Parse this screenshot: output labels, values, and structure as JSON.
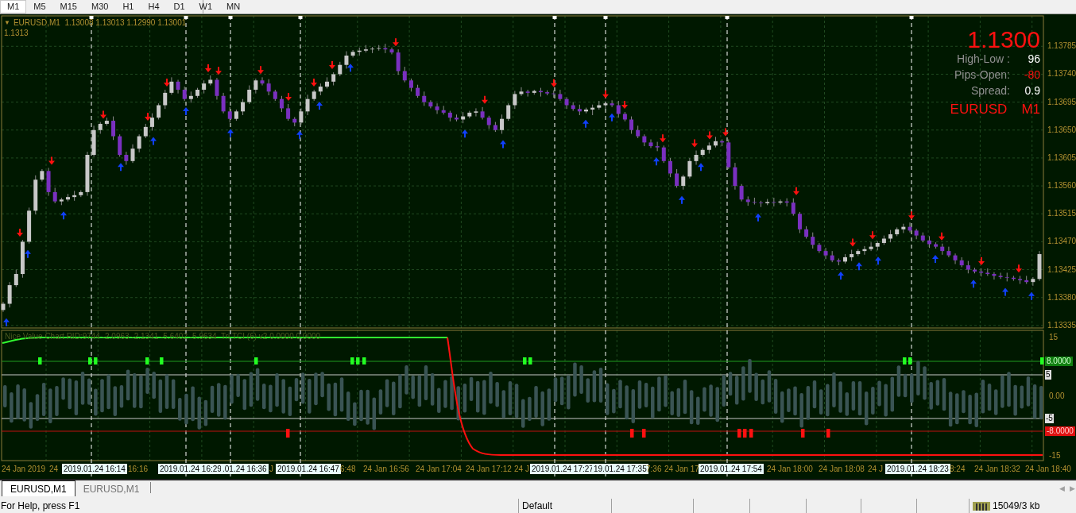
{
  "timeframes": [
    {
      "label": "M1",
      "selected": true
    },
    {
      "label": "M5",
      "selected": false
    },
    {
      "label": "M15",
      "selected": false
    },
    {
      "label": "M30",
      "selected": false
    },
    {
      "label": "H1",
      "selected": false
    },
    {
      "label": "H4",
      "selected": false
    },
    {
      "label": "D1",
      "selected": false
    },
    {
      "label": "W1",
      "selected": false
    },
    {
      "label": "MN",
      "selected": false
    }
  ],
  "chart": {
    "menu_glyph": "▼",
    "header": "EURUSD,M1  1.13008 1.13013 1.12990 1.13001",
    "header_line_2": "1.1313",
    "info_panel": {
      "price": "1.1300",
      "rows": [
        {
          "label": "High-Low :",
          "value": "96",
          "kind": "neutral"
        },
        {
          "label": "Pips-Open:",
          "value": "-80",
          "kind": "negative"
        },
        {
          "label": "Spread:",
          "value": "0.9",
          "kind": "neutral"
        }
      ],
      "symbol": "EURUSD",
      "period": "M1"
    },
    "chart_data": {
      "type": "candlestick",
      "grid": true,
      "ylim": [
        1.13331,
        1.13834
      ],
      "yticks": [
        {
          "value": 1.13785,
          "label": "1.13785"
        },
        {
          "value": 1.1374,
          "label": "1.13740"
        },
        {
          "value": 1.13695,
          "label": "1.13695"
        },
        {
          "value": 1.1365,
          "label": "1.13650"
        },
        {
          "value": 1.13605,
          "label": "1.13605"
        },
        {
          "value": 1.1356,
          "label": "1.13560"
        },
        {
          "value": 1.13515,
          "label": "1.13515"
        },
        {
          "value": 1.1347,
          "label": "1.13470"
        },
        {
          "value": 1.13425,
          "label": "1.13425"
        },
        {
          "value": 1.1338,
          "label": "1.13380"
        },
        {
          "value": 1.13335,
          "label": "1.13335"
        }
      ],
      "ohlc": [
        [
          1.1336,
          1.13373,
          1.13357,
          1.1337
        ],
        [
          1.1337,
          1.13405,
          1.13364,
          1.134
        ],
        [
          1.134,
          1.13425,
          1.13397,
          1.13418
        ],
        [
          1.13418,
          1.13473,
          1.13412,
          1.1347
        ],
        [
          1.1347,
          1.13525,
          1.13467,
          1.1352
        ],
        [
          1.1352,
          1.13577,
          1.13514,
          1.1357
        ],
        [
          1.1357,
          1.13587,
          1.13567,
          1.13584
        ],
        [
          1.13584,
          1.13589,
          1.13544,
          1.1355
        ],
        [
          1.1355,
          1.13557,
          1.13532,
          1.13535
        ],
        [
          1.13535,
          1.13541,
          1.13529,
          1.13538
        ],
        [
          1.13538,
          1.13547,
          1.13535,
          1.13542
        ],
        [
          1.13542,
          1.13552,
          1.13536,
          1.13545
        ],
        [
          1.13545,
          1.13553,
          1.13542,
          1.1355
        ],
        [
          1.1355,
          1.13615,
          1.13544,
          1.1361
        ],
        [
          1.1361,
          1.13657,
          1.13607,
          1.1365
        ],
        [
          1.1365,
          1.13663,
          1.13644,
          1.1366
        ],
        [
          1.1366,
          1.1367,
          1.13657,
          1.13665
        ],
        [
          1.13665,
          1.13672,
          1.13634,
          1.1364
        ],
        [
          1.1364,
          1.13643,
          1.13607,
          1.1361
        ],
        [
          1.1361,
          1.13615,
          1.13594,
          1.136
        ],
        [
          1.136,
          1.13627,
          1.13597,
          1.1362
        ],
        [
          1.1362,
          1.13643,
          1.13614,
          1.1364
        ],
        [
          1.1364,
          1.1366,
          1.13637,
          1.13655
        ],
        [
          1.13655,
          1.13677,
          1.13649,
          1.1367
        ],
        [
          1.1367,
          1.13693,
          1.13667,
          1.1369
        ],
        [
          1.1369,
          1.13715,
          1.13684,
          1.1371
        ],
        [
          1.1371,
          1.13735,
          1.13707,
          1.13728
        ],
        [
          1.13728,
          1.13731,
          1.13709,
          1.13715
        ],
        [
          1.13715,
          1.1372,
          1.13697,
          1.137
        ],
        [
          1.137,
          1.13712,
          1.13694,
          1.13705
        ],
        [
          1.13705,
          1.13718,
          1.13702,
          1.13715
        ],
        [
          1.13715,
          1.1373,
          1.13709,
          1.13725
        ],
        [
          1.13725,
          1.13738,
          1.13722,
          1.13731
        ],
        [
          1.13731,
          1.13734,
          1.13699,
          1.13705
        ],
        [
          1.13705,
          1.1371,
          1.13677,
          1.1368
        ],
        [
          1.1368,
          1.13687,
          1.13662,
          1.13668
        ],
        [
          1.13668,
          1.13683,
          1.13665,
          1.1368
        ],
        [
          1.1368,
          1.137,
          1.13674,
          1.13695
        ],
        [
          1.13695,
          1.13722,
          1.13692,
          1.13715
        ],
        [
          1.13715,
          1.13733,
          1.13709,
          1.1373
        ],
        [
          1.1373,
          1.13735,
          1.13722,
          1.13725
        ],
        [
          1.13725,
          1.13732,
          1.13706,
          1.13712
        ],
        [
          1.13712,
          1.13715,
          1.13697,
          1.137
        ],
        [
          1.137,
          1.13705,
          1.13679,
          1.13685
        ],
        [
          1.13685,
          1.13692,
          1.13665,
          1.13668
        ],
        [
          1.13668,
          1.13671,
          1.13656,
          1.13662
        ],
        [
          1.13662,
          1.13685,
          1.13659,
          1.1368
        ],
        [
          1.1368,
          1.13707,
          1.13674,
          1.137
        ],
        [
          1.137,
          1.13715,
          1.13697,
          1.13712
        ],
        [
          1.13712,
          1.13725,
          1.13706,
          1.1372
        ],
        [
          1.1372,
          1.13735,
          1.13717,
          1.13728
        ],
        [
          1.13728,
          1.13743,
          1.13722,
          1.1374
        ],
        [
          1.1374,
          1.1376,
          1.13737,
          1.13755
        ],
        [
          1.13755,
          1.13777,
          1.13749,
          1.1377
        ],
        [
          1.1377,
          1.13779,
          1.13767,
          1.13776
        ],
        [
          1.13776,
          1.13783,
          1.1377,
          1.13778
        ],
        [
          1.13778,
          1.13787,
          1.13775,
          1.1378
        ],
        [
          1.1378,
          1.13784,
          1.13774,
          1.13781
        ],
        [
          1.13781,
          1.13787,
          1.13778,
          1.13782
        ],
        [
          1.13782,
          1.13789,
          1.13774,
          1.1378
        ],
        [
          1.1378,
          1.13783,
          1.13772,
          1.13775
        ],
        [
          1.13775,
          1.1378,
          1.13739,
          1.13745
        ],
        [
          1.13745,
          1.13752,
          1.13727,
          1.1373
        ],
        [
          1.1373,
          1.13733,
          1.13712,
          1.13718
        ],
        [
          1.13718,
          1.13723,
          1.13702,
          1.13705
        ],
        [
          1.13705,
          1.13712,
          1.13689,
          1.13695
        ],
        [
          1.13695,
          1.13698,
          1.13685,
          1.13688
        ],
        [
          1.13688,
          1.13693,
          1.13676,
          1.13682
        ],
        [
          1.13682,
          1.13689,
          1.13675,
          1.13678
        ],
        [
          1.13678,
          1.13681,
          1.13664,
          1.1367
        ],
        [
          1.1367,
          1.13675,
          1.13664,
          1.13667
        ],
        [
          1.13667,
          1.13679,
          1.13661,
          1.13672
        ],
        [
          1.13672,
          1.13681,
          1.13669,
          1.13678
        ],
        [
          1.13678,
          1.13685,
          1.13672,
          1.1368
        ],
        [
          1.1368,
          1.13687,
          1.13667,
          1.1367
        ],
        [
          1.1367,
          1.13673,
          1.13652,
          1.13658
        ],
        [
          1.13658,
          1.13663,
          1.13647,
          1.1365
        ],
        [
          1.1365,
          1.13675,
          1.13644,
          1.13668
        ],
        [
          1.13668,
          1.13693,
          1.13665,
          1.1369
        ],
        [
          1.1369,
          1.13713,
          1.13684,
          1.13708
        ],
        [
          1.13708,
          1.13719,
          1.13705,
          1.13712
        ],
        [
          1.13712,
          1.13715,
          1.13704,
          1.1371
        ],
        [
          1.1371,
          1.13715,
          1.13707,
          1.13713
        ],
        [
          1.13713,
          1.13718,
          1.13704,
          1.13711
        ],
        [
          1.13711,
          1.13714,
          1.13706,
          1.13709
        ],
        [
          1.13709,
          1.13714,
          1.13702,
          1.13708
        ],
        [
          1.13708,
          1.13715,
          1.13697,
          1.137
        ],
        [
          1.137,
          1.13703,
          1.13684,
          1.1369
        ],
        [
          1.1369,
          1.13695,
          1.13681,
          1.13684
        ],
        [
          1.13684,
          1.13691,
          1.13674,
          1.1368
        ],
        [
          1.1368,
          1.13686,
          1.13677,
          1.13683
        ],
        [
          1.13683,
          1.13691,
          1.13674,
          1.13686
        ],
        [
          1.13686,
          1.13697,
          1.13683,
          1.1369
        ],
        [
          1.1369,
          1.13696,
          1.13684,
          1.13693
        ],
        [
          1.13693,
          1.13698,
          1.13687,
          1.1369
        ],
        [
          1.1369,
          1.13697,
          1.1367,
          1.13676
        ],
        [
          1.13676,
          1.13679,
          1.13664,
          1.13667
        ],
        [
          1.13667,
          1.13672,
          1.13644,
          1.1365
        ],
        [
          1.1365,
          1.13657,
          1.13637,
          1.1364
        ],
        [
          1.1364,
          1.13643,
          1.13624,
          1.1363
        ],
        [
          1.1363,
          1.13635,
          1.13621,
          1.13624
        ],
        [
          1.13624,
          1.13631,
          1.13616,
          1.13622
        ],
        [
          1.13622,
          1.13625,
          1.13597,
          1.136
        ],
        [
          1.136,
          1.13605,
          1.13574,
          1.1358
        ],
        [
          1.1358,
          1.13587,
          1.13557,
          1.1356
        ],
        [
          1.1356,
          1.13578,
          1.13554,
          1.13575
        ],
        [
          1.13575,
          1.13605,
          1.13572,
          1.136
        ],
        [
          1.136,
          1.13617,
          1.13594,
          1.1361
        ],
        [
          1.1361,
          1.13621,
          1.13607,
          1.13618
        ],
        [
          1.13618,
          1.1363,
          1.13612,
          1.13625
        ],
        [
          1.13625,
          1.13639,
          1.13622,
          1.13632
        ],
        [
          1.13632,
          1.13635,
          1.13624,
          1.1363
        ],
        [
          1.1363,
          1.13635,
          1.13587,
          1.1359
        ],
        [
          1.1359,
          1.13597,
          1.13554,
          1.1356
        ],
        [
          1.1356,
          1.13563,
          1.13535,
          1.13538
        ],
        [
          1.13538,
          1.13543,
          1.13528,
          1.13534
        ],
        [
          1.13534,
          1.13541,
          1.1353,
          1.13533
        ],
        [
          1.13533,
          1.13536,
          1.13526,
          1.13532
        ],
        [
          1.13532,
          1.13539,
          1.13529,
          1.13534
        ],
        [
          1.13534,
          1.13541,
          1.13527,
          1.13533
        ],
        [
          1.13533,
          1.13538,
          1.1353,
          1.13535
        ],
        [
          1.13535,
          1.1354,
          1.13527,
          1.13533
        ],
        [
          1.13533,
          1.1354,
          1.13512,
          1.13515
        ],
        [
          1.13515,
          1.13518,
          1.13484,
          1.1349
        ],
        [
          1.1349,
          1.13495,
          1.13475,
          1.13478
        ],
        [
          1.13478,
          1.13485,
          1.13459,
          1.13465
        ],
        [
          1.13465,
          1.13468,
          1.13452,
          1.13455
        ],
        [
          1.13455,
          1.1346,
          1.13442,
          1.13448
        ],
        [
          1.13448,
          1.13455,
          1.13437,
          1.1344
        ],
        [
          1.1344,
          1.13443,
          1.13432,
          1.13438
        ],
        [
          1.13438,
          1.1345,
          1.13435,
          1.13445
        ],
        [
          1.13445,
          1.13457,
          1.13439,
          1.1345
        ],
        [
          1.1345,
          1.13458,
          1.13447,
          1.13455
        ],
        [
          1.13455,
          1.13463,
          1.13449,
          1.13458
        ],
        [
          1.13458,
          1.13469,
          1.13455,
          1.13462
        ],
        [
          1.13462,
          1.13471,
          1.13456,
          1.13468
        ],
        [
          1.13468,
          1.1348,
          1.13465,
          1.13475
        ],
        [
          1.13475,
          1.13489,
          1.13469,
          1.13482
        ],
        [
          1.13482,
          1.13493,
          1.13479,
          1.1349
        ],
        [
          1.1349,
          1.13499,
          1.13484,
          1.13494
        ],
        [
          1.13494,
          1.13501,
          1.13485,
          1.13488
        ],
        [
          1.13488,
          1.13491,
          1.13474,
          1.1348
        ],
        [
          1.1348,
          1.13485,
          1.13469,
          1.13472
        ],
        [
          1.13472,
          1.13479,
          1.1346,
          1.13466
        ],
        [
          1.13466,
          1.13469,
          1.13459,
          1.13462
        ],
        [
          1.13462,
          1.13467,
          1.13449,
          1.13455
        ],
        [
          1.13455,
          1.13462,
          1.13445,
          1.13448
        ],
        [
          1.13448,
          1.13451,
          1.13434,
          1.1344
        ],
        [
          1.1344,
          1.13445,
          1.13429,
          1.13432
        ],
        [
          1.13432,
          1.13439,
          1.13419,
          1.13425
        ],
        [
          1.13425,
          1.13428,
          1.13419,
          1.13422
        ],
        [
          1.13422,
          1.13427,
          1.13414,
          1.1342
        ],
        [
          1.1342,
          1.13427,
          1.13415,
          1.13418
        ],
        [
          1.13418,
          1.13421,
          1.13409,
          1.13415
        ],
        [
          1.13415,
          1.1342,
          1.1341,
          1.13413
        ],
        [
          1.13413,
          1.1342,
          1.13406,
          1.13412
        ],
        [
          1.13412,
          1.13415,
          1.13407,
          1.1341
        ],
        [
          1.1341,
          1.13415,
          1.13402,
          1.13408
        ],
        [
          1.13408,
          1.13415,
          1.13402,
          1.13405
        ],
        [
          1.13405,
          1.13413,
          1.13399,
          1.1341
        ],
        [
          1.1341,
          1.13455,
          1.13407,
          1.1345
        ]
      ]
    },
    "indicator": {
      "label": "Nice Value Chart RID:9744 -2.0963 -2.1341 -5.6402 -5.9634  Tri TCI (6) v2 0.0000 0.0000",
      "axis": [
        {
          "text": "15",
          "kind": "plain"
        },
        {
          "text": "8.0000",
          "kind": "green"
        },
        {
          "text": "5",
          "kind": "white"
        },
        {
          "text": "0.00",
          "kind": "plain"
        },
        {
          "text": "-5",
          "kind": "white"
        },
        {
          "text": "-8.0000",
          "kind": "red"
        },
        {
          "text": "-15",
          "kind": "plain"
        }
      ]
    },
    "time_axis": [
      {
        "text": "24 Jan 2019",
        "kind": "tick"
      },
      {
        "text": "24",
        "kind": "tick"
      },
      {
        "text": "2019.01.24 16:14",
        "kind": "marker"
      },
      {
        "text": "16:16",
        "kind": "tick"
      },
      {
        "text": "2019.01.24 16:29",
        "kind": "marker"
      },
      {
        "text": ".01.24 16:36",
        "kind": "marker"
      },
      {
        "text": "J",
        "kind": "tick"
      },
      {
        "text": "2019.01.24 16:47",
        "kind": "marker"
      },
      {
        "text": "6:48",
        "kind": "tick"
      },
      {
        "text": "24 Jan 16:56",
        "kind": "tick"
      },
      {
        "text": "24 Jan 17:04",
        "kind": "tick"
      },
      {
        "text": "24 Jan 17:12",
        "kind": "tick"
      },
      {
        "text": "24 J",
        "kind": "tick"
      },
      {
        "text": "2019.01.24 17:27",
        "kind": "marker"
      },
      {
        "text": "19.01.24 17:35",
        "kind": "marker"
      },
      {
        "text": "7:36",
        "kind": "tick"
      },
      {
        "text": "24 Jan 17",
        "kind": "tick"
      },
      {
        "text": "2019.01.24 17:54",
        "kind": "marker"
      },
      {
        "text": "24 Jan 18:00",
        "kind": "tick"
      },
      {
        "text": "24 Jan 18:08",
        "kind": "tick"
      },
      {
        "text": "24 J",
        "kind": "tick"
      },
      {
        "text": "2019.01.24 18:23",
        "kind": "marker"
      },
      {
        "text": "8:24",
        "kind": "tick"
      },
      {
        "text": "24 Jan 18:32",
        "kind": "tick"
      },
      {
        "text": "24 Jan 18:40",
        "kind": "tick"
      }
    ]
  },
  "chart_tabs": [
    {
      "label": "EURUSD,M1",
      "selected": true
    },
    {
      "label": "EURUSD,M1",
      "selected": false
    }
  ],
  "tab_scroll": [
    "◀",
    "▶"
  ],
  "status_bar": {
    "help": "For Help, press F1",
    "profile": "Default",
    "traffic": "15049/3 kb"
  }
}
